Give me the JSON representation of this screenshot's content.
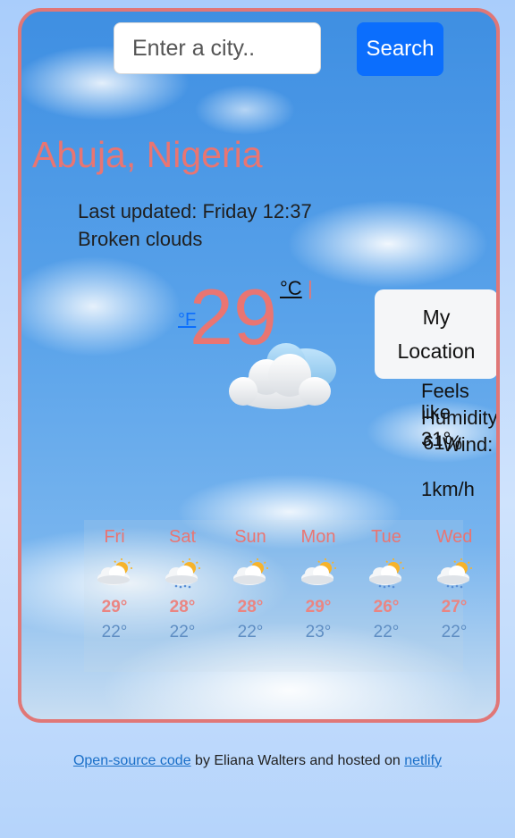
{
  "search": {
    "placeholder": "Enter a city..",
    "button_label": "Search"
  },
  "current": {
    "city": "Abuja, Nigeria",
    "last_updated": "Last updated: Friday 12:37",
    "description": "Broken clouds",
    "temperature": "29",
    "unit_f": "°F",
    "unit_c": "°C",
    "unit_separator": "|",
    "icon": "broken-clouds-icon"
  },
  "location_button": {
    "line1": "My",
    "line2": "Location"
  },
  "details": {
    "feels_like_label": "Feels like",
    "feels_like_value": "31°",
    "humidity_label": "Humidity:",
    "humidity_value": "61%",
    "wind_label": "Wind:",
    "wind_value": "1km/h"
  },
  "forecast": [
    {
      "day": "Fri",
      "max": "29°",
      "min": "22°",
      "icon": "partly-cloudy-icon"
    },
    {
      "day": "Sat",
      "max": "28°",
      "min": "22°",
      "icon": "partly-cloudy-rain-icon"
    },
    {
      "day": "Sun",
      "max": "28°",
      "min": "22°",
      "icon": "partly-cloudy-icon"
    },
    {
      "day": "Mon",
      "max": "29°",
      "min": "23°",
      "icon": "partly-cloudy-icon"
    },
    {
      "day": "Tue",
      "max": "26°",
      "min": "22°",
      "icon": "partly-cloudy-rain-icon"
    },
    {
      "day": "Wed",
      "max": "27°",
      "min": "22°",
      "icon": "partly-cloudy-rain-icon"
    }
  ],
  "footer": {
    "link1": "Open-source code",
    "text1": " by Eliana Walters and hosted on ",
    "link2": "netlify"
  },
  "colors": {
    "accent": "#e97572",
    "border": "#e07777",
    "button": "#0b6efd",
    "min_temp": "#5f8ec3"
  }
}
